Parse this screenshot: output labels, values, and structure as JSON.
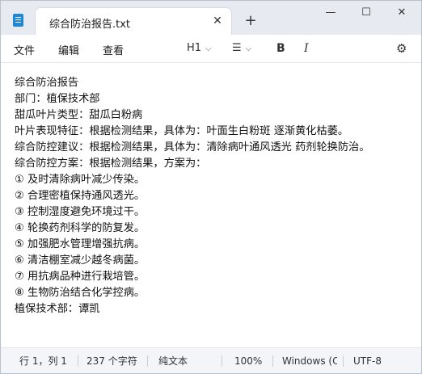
{
  "tab": {
    "title": "综合防治报告.txt",
    "close_glyph": "✕",
    "new_tab_glyph": "+"
  },
  "window_controls": {
    "minimize": "—",
    "maximize": "☐",
    "close": "✕"
  },
  "menu": {
    "file": "文件",
    "edit": "编辑",
    "view": "查看"
  },
  "toolbar": {
    "heading": "H1",
    "list_glyph": "☰",
    "bold": "B",
    "italic": "I",
    "settings_glyph": "⚙"
  },
  "document": {
    "lines": [
      "综合防治报告",
      "部门：植保技术部",
      "甜瓜叶片类型：甜瓜白粉病",
      "叶片表现特征：根据检测结果，具体为：叶面生白粉斑 逐渐黄化枯萎。",
      "综合防控建议：根据检测结果，具体为：清除病叶通风透光 药剂轮换防治。",
      "综合防控方案：根据检测结果，方案为：",
      "① 及时清除病叶减少传染。",
      "② 合理密植保持通风透光。",
      "③ 控制湿度避免环境过干。",
      "④ 轮换药剂科学的防复发。",
      "⑤ 加强肥水管理增强抗病。",
      "⑥ 清洁棚室减少越冬病菌。",
      "⑦ 用抗病品种进行栽培管。",
      "⑧ 生物防治结合化学控病。",
      "植保技术部：谭凯"
    ]
  },
  "status": {
    "position": "行 1，列 1",
    "char_count": "237 个字符",
    "format": "纯文本",
    "zoom": "100%",
    "line_ending": "Windows (CR",
    "encoding": "UTF-8"
  },
  "colors": {
    "app_icon": "#1c88d6",
    "titlebar_bg": "#e7ebf1",
    "statusbar_bg": "#f3f5f8"
  }
}
